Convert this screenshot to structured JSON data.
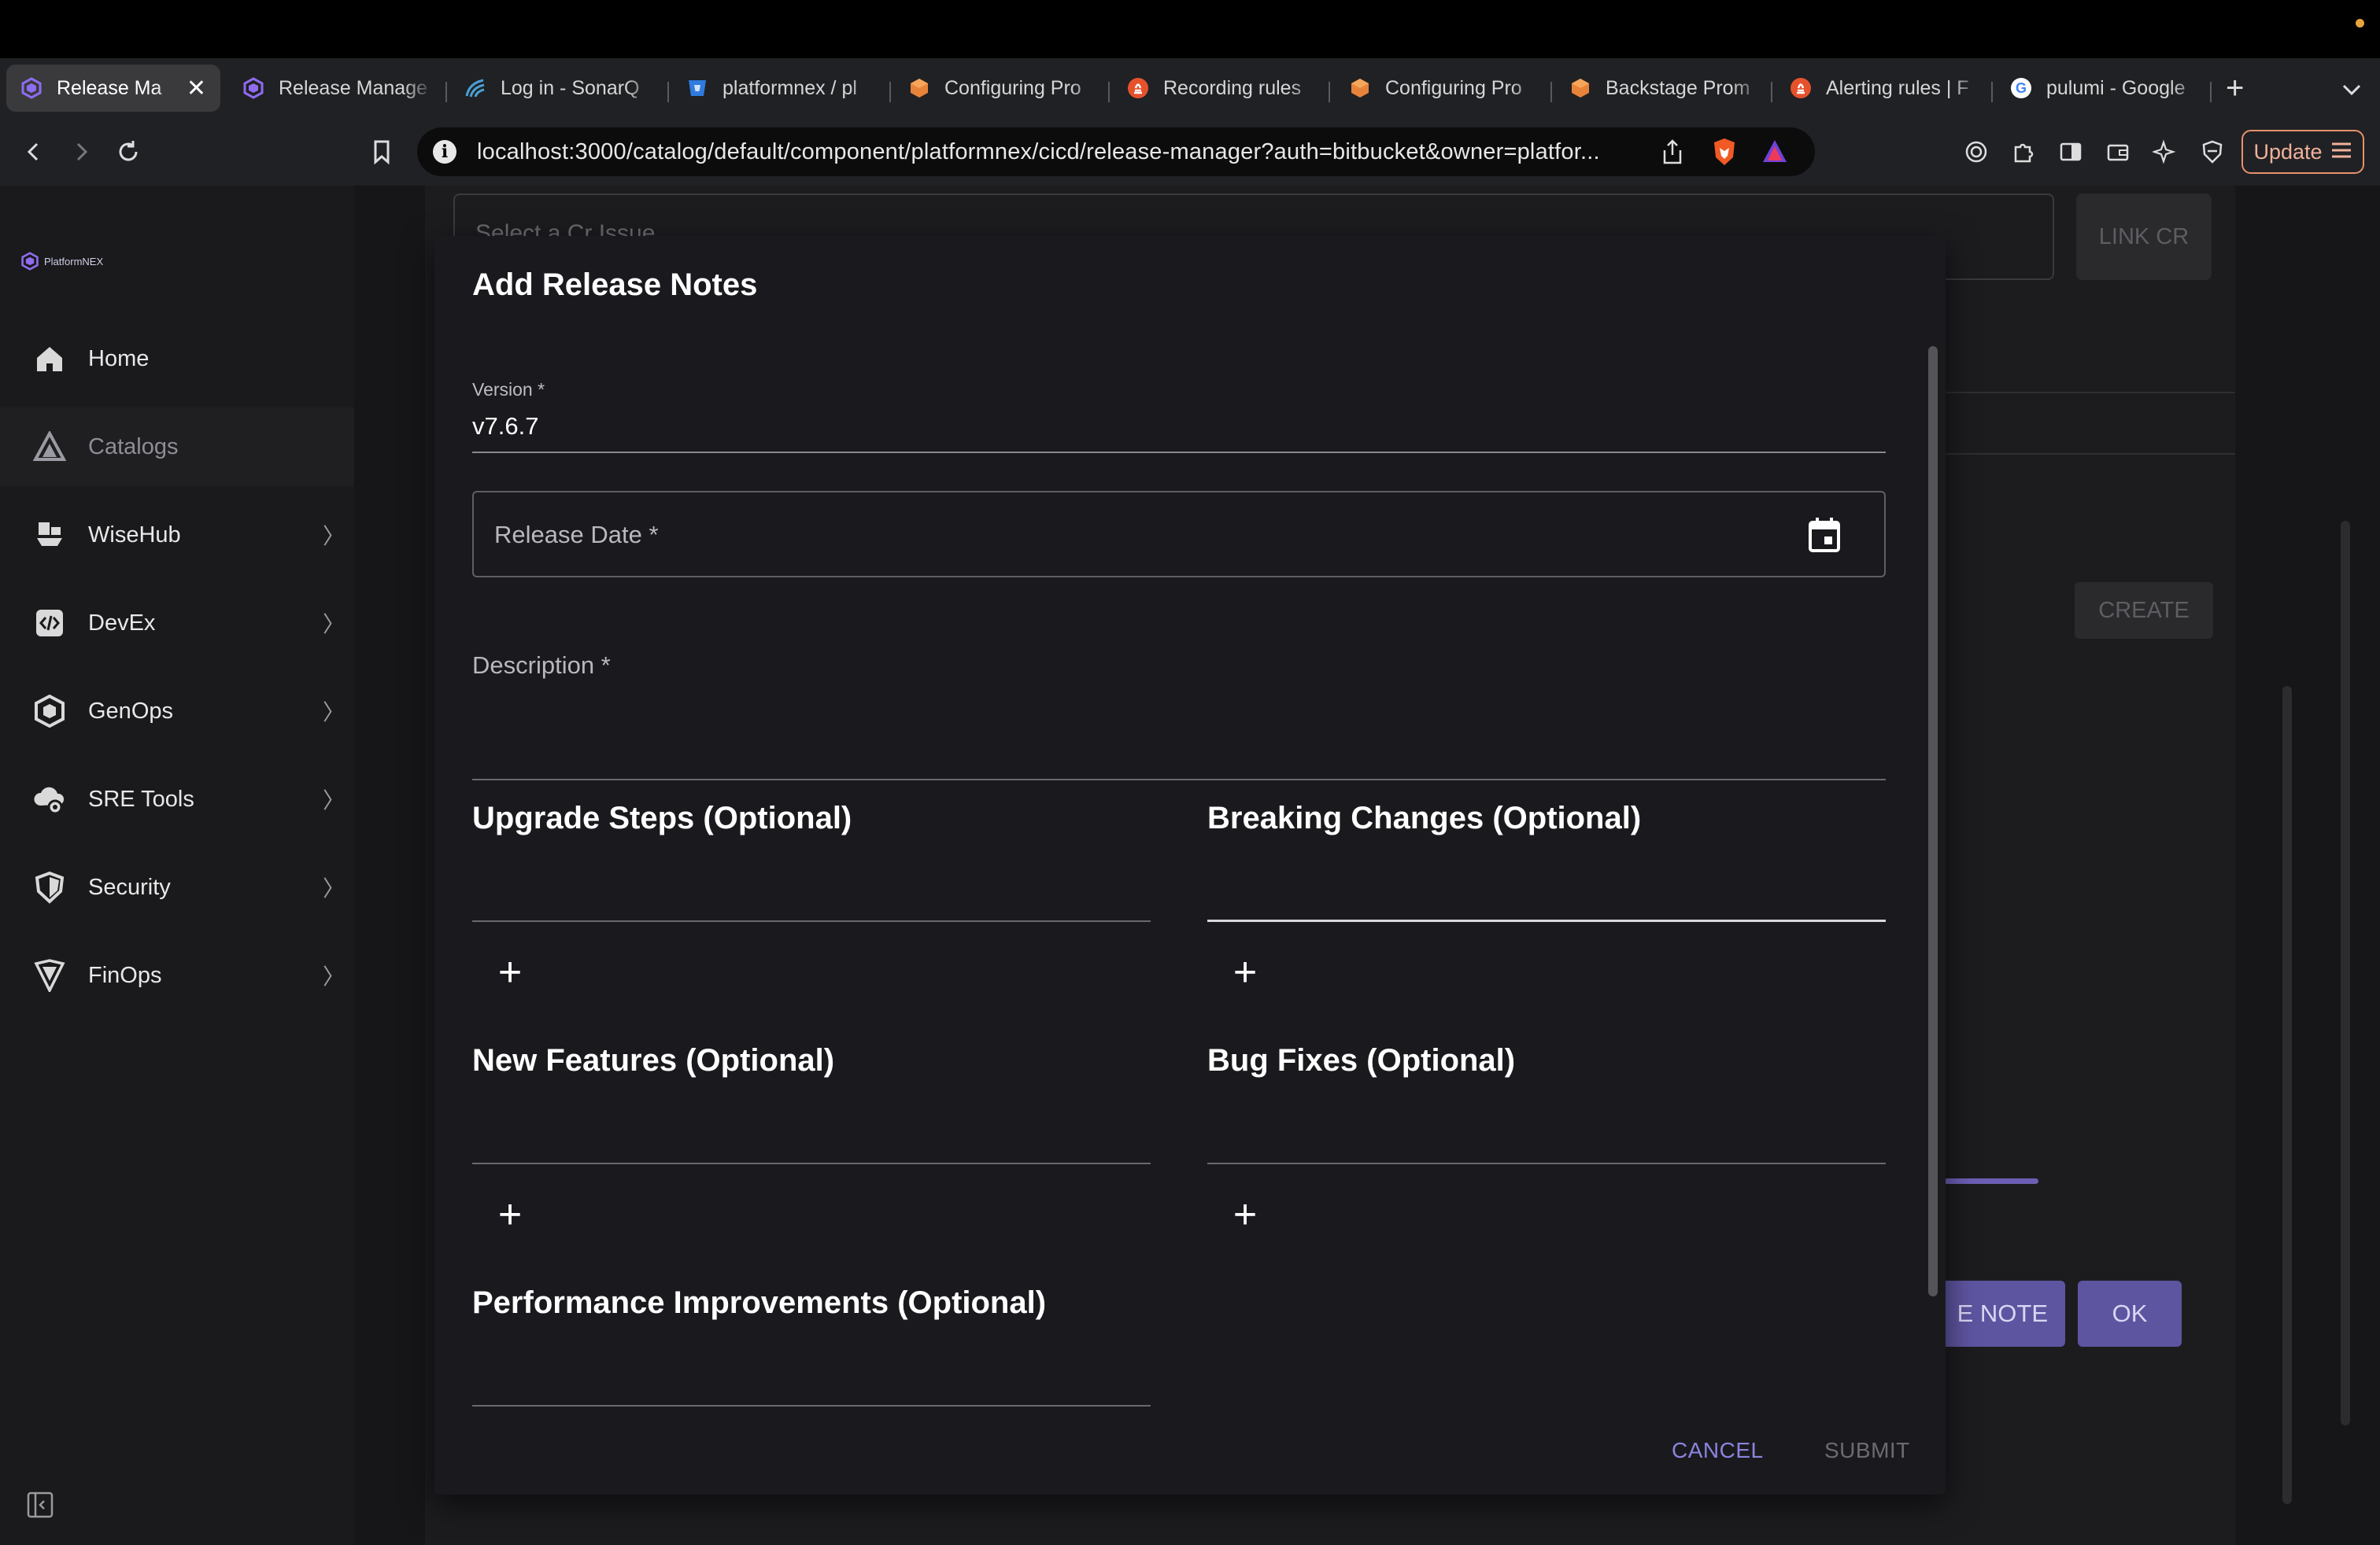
{
  "browser": {
    "tabs": [
      {
        "label": "Release Ma",
        "icon": "backstage-icon",
        "active": true
      },
      {
        "label": "Release Manage",
        "icon": "backstage-icon"
      },
      {
        "label": "Log in - SonarQ",
        "icon": "sonarqube-icon"
      },
      {
        "label": "platformnex / pl",
        "icon": "bitbucket-icon"
      },
      {
        "label": "Configuring Pro",
        "icon": "cube-icon"
      },
      {
        "label": "Recording rules",
        "icon": "prometheus-icon"
      },
      {
        "label": "Configuring Pro",
        "icon": "cube-icon"
      },
      {
        "label": "Backstage Prom",
        "icon": "cube-icon"
      },
      {
        "label": "Alerting rules | F",
        "icon": "prometheus-icon"
      },
      {
        "label": "pulumi - Google",
        "icon": "google-icon"
      }
    ],
    "close_glyph": "✕",
    "new_tab_glyph": "+",
    "url": "localhost:3000/catalog/default/component/platformnex/cicd/release-manager?auth=bitbucket&owner=platfor...",
    "update_label": "Update"
  },
  "sidebar": {
    "logo_text": "PlatformNEX",
    "items": [
      {
        "label": "Home",
        "icon": "home-icon",
        "chevron": ""
      },
      {
        "label": "Catalogs",
        "icon": "catalog-icon",
        "chevron": "",
        "active": true
      },
      {
        "label": "WiseHub",
        "icon": "wisehub-icon",
        "chevron": "〉"
      },
      {
        "label": "DevEx",
        "icon": "code-icon",
        "chevron": "〉"
      },
      {
        "label": "GenOps",
        "icon": "genops-icon",
        "chevron": "〉"
      },
      {
        "label": "SRE Tools",
        "icon": "cloud-gear-icon",
        "chevron": "〉"
      },
      {
        "label": "Security",
        "icon": "shield-icon",
        "chevron": "〉"
      },
      {
        "label": "FinOps",
        "icon": "finops-icon",
        "chevron": "〉"
      }
    ]
  },
  "background": {
    "select_placeholder": "Select a Cr Issue",
    "link_cr_label": "LINK CR",
    "create_label": "CREATE",
    "release_note_label": "E NOTE",
    "ok_label": "OK"
  },
  "dialog": {
    "title": "Add Release Notes",
    "version_label": "Version *",
    "version_value": "v7.6.7",
    "release_date_label": "Release Date *",
    "description_label": "Description *",
    "sections": {
      "upgrade": "Upgrade Steps (Optional)",
      "breaking": "Breaking Changes (Optional)",
      "features": "New Features (Optional)",
      "bugfixes": "Bug Fixes (Optional)",
      "performance": "Performance Improvements (Optional)"
    },
    "add_glyph": "+",
    "cancel_label": "CANCEL",
    "submit_label": "SUBMIT"
  },
  "colors": {
    "accent": "#8b84e0",
    "button_bg": "#5e55a0",
    "dialog_bg": "#1a1a1e",
    "sidebar_bg": "#1a1a1c"
  }
}
